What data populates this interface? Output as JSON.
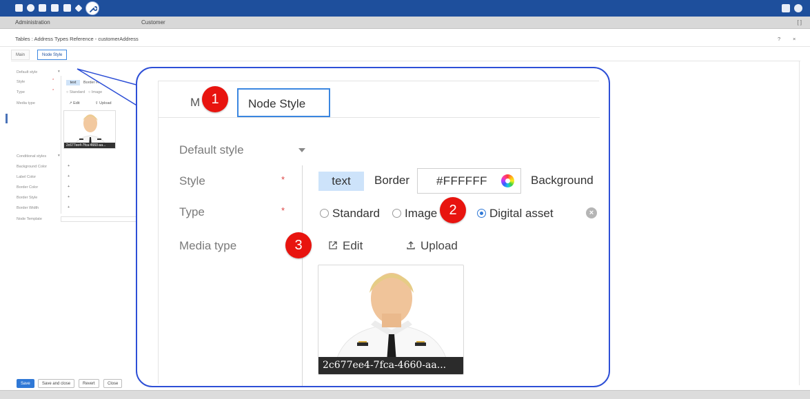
{
  "topbar": {
    "icons": [
      "brand-icon",
      "help-icon",
      "document-icon",
      "copy-icon",
      "file-icon",
      "pin-icon",
      "wrench-icon"
    ],
    "right_icons": [
      "book-icon",
      "user-icon"
    ]
  },
  "menu": {
    "items": [
      "Administration",
      "Customer"
    ]
  },
  "breadcrumb": {
    "text": "Tables  :  Address Types Reference - customerAddress",
    "help": "?",
    "close": "×"
  },
  "tabs": [
    "Main",
    "Node Style"
  ],
  "form_small": {
    "default_style": "Default style",
    "style": "Style",
    "type": "Type",
    "media_type": "Media type",
    "conditional_styles": "Conditional styles",
    "background_color": "Background Color",
    "label_color": "Label Color",
    "border_color": "Border Color",
    "border_style": "Border Style",
    "border_width": "Border Width",
    "node_template": "Node Template",
    "text_chip": "text",
    "border_value": "Border  #FFFFFF",
    "standard": "Standard",
    "image": "Image",
    "edit": "Edit",
    "upload": "Upload",
    "thumb_caption": "2c677ee4-7fca-4660-aa...",
    "plus": "+"
  },
  "buttons": {
    "save": "Save",
    "save_and_close": "Save and close",
    "revert": "Revert",
    "close": "Close"
  },
  "zoom": {
    "tab_main": "M",
    "tab_node_style": "Node Style",
    "default_style": "Default style",
    "style": "Style",
    "type": "Type",
    "media_type": "Media type",
    "required_mark": "*",
    "text_chip": "text",
    "border_label": "Border",
    "border_color": "#FFFFFF",
    "background_label": "Background",
    "radio_standard": "Standard",
    "radio_image": "Image",
    "radio_digital_asset": "Digital asset",
    "edit": "Edit",
    "upload": "Upload",
    "thumb_caption": "2c677ee4-7fca-4660-aa..."
  },
  "badges": [
    "1",
    "2",
    "3"
  ],
  "colors": {
    "topbar": "#1e4f9c",
    "callout_border": "#2d4fd6",
    "badge": "#e8140f",
    "tab_active_border": "#3a86e0",
    "text_chip_bg": "#cde3fa"
  }
}
